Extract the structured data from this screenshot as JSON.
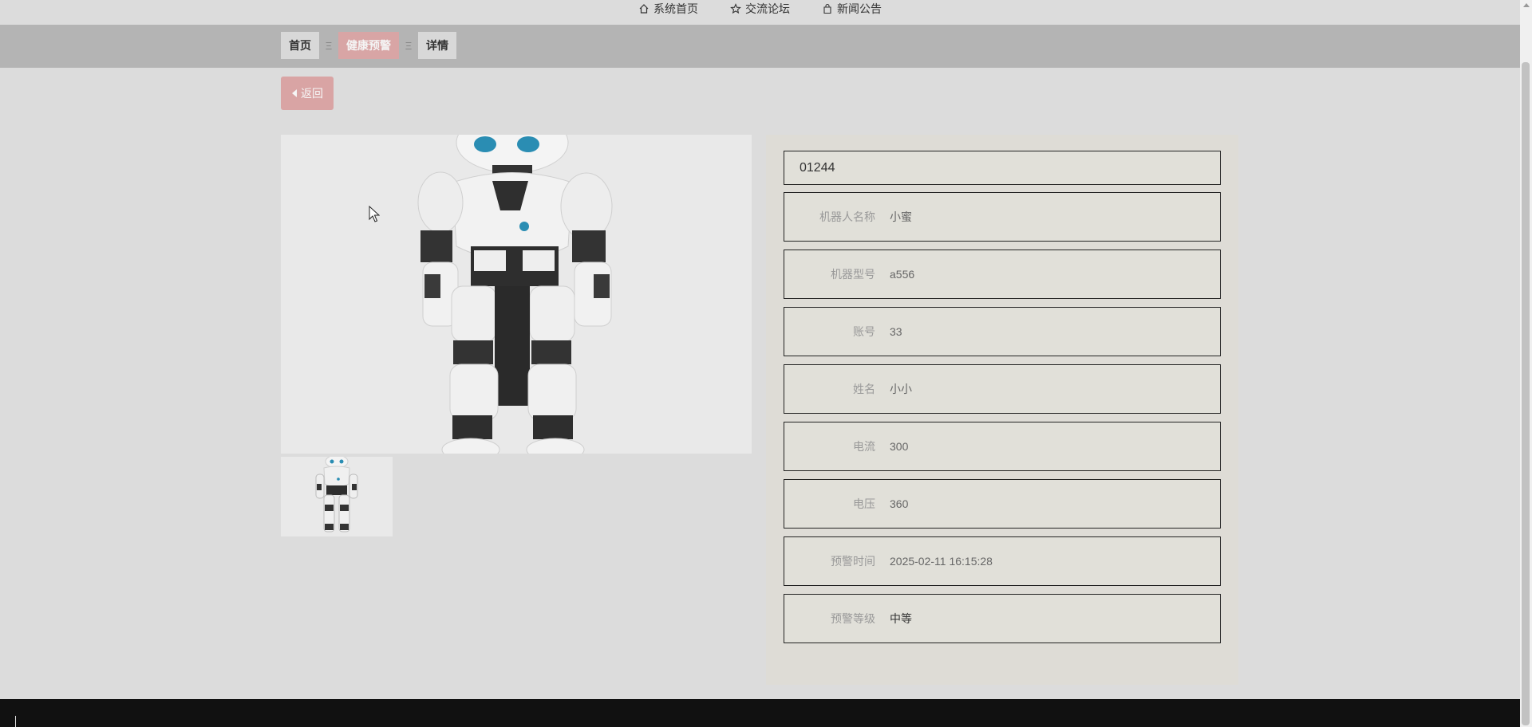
{
  "nav": {
    "items": [
      {
        "label": "系统首页",
        "icon": "home-icon"
      },
      {
        "label": "交流论坛",
        "icon": "star-icon"
      },
      {
        "label": "新闻公告",
        "icon": "bag-icon"
      }
    ]
  },
  "breadcrumb": {
    "items": [
      {
        "label": "首页"
      },
      {
        "label": "健康预警"
      },
      {
        "label": "详情"
      }
    ],
    "separator": "Ξ"
  },
  "back_button": {
    "label": "返回",
    "icon": "caret-left-icon"
  },
  "detail": {
    "id": "01244",
    "fields": [
      {
        "label": "机器人名称",
        "value": "小蜜"
      },
      {
        "label": "机器型号",
        "value": "a556"
      },
      {
        "label": "账号",
        "value": "33"
      },
      {
        "label": "姓名",
        "value": "小小"
      },
      {
        "label": "电流",
        "value": "300"
      },
      {
        "label": "电压",
        "value": "360"
      },
      {
        "label": "预警时间",
        "value": "2025-02-11 16:15:28"
      },
      {
        "label": "预警等级",
        "value": "中等"
      }
    ]
  },
  "colors": {
    "breadcrumb_active": "#d8a5a5",
    "back_button": "#d9a4a4",
    "footer": "#111111",
    "robot_accent": "#2a8db3"
  }
}
